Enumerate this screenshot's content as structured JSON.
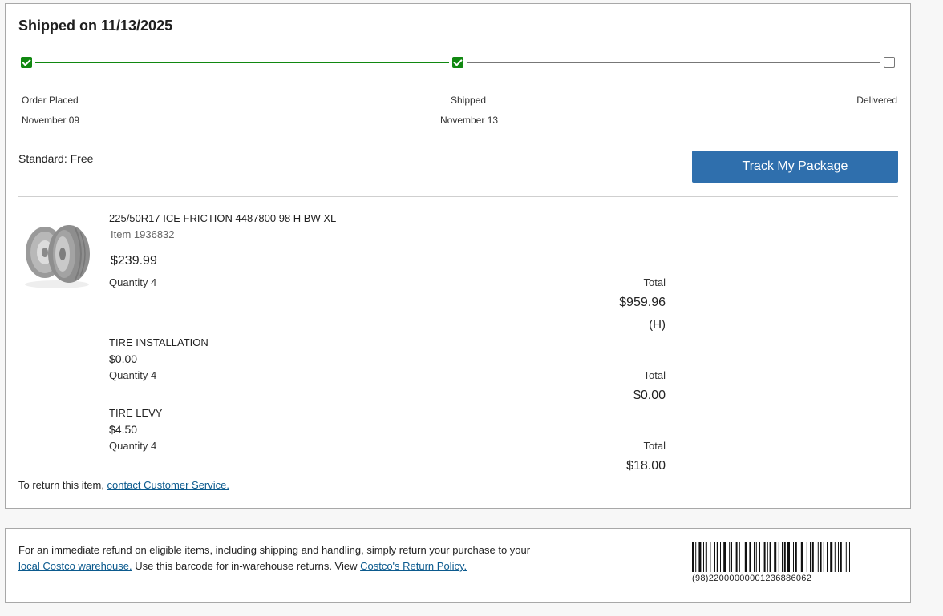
{
  "shipment": {
    "title": "Shipped on 11/13/2025",
    "steps": [
      {
        "label": "Order Placed",
        "date": "November 09",
        "status": "done"
      },
      {
        "label": "Shipped",
        "date": "November 13",
        "status": "done"
      },
      {
        "label": "Delivered",
        "date": "",
        "status": "pending"
      }
    ],
    "shipping_method": "Standard: Free",
    "track_button": "Track My Package"
  },
  "items": [
    {
      "name": "225/50R17 ICE FRICTION 4487800 98 H BW XL",
      "item_number": "Item 1936832",
      "price": "$239.99",
      "quantity": "Quantity 4",
      "total_label": "Total",
      "total": "$959.96",
      "tax_flag": "(H)",
      "image_icon": "tire-icon"
    },
    {
      "name": "TIRE INSTALLATION",
      "price": "$0.00",
      "quantity": "Quantity 4",
      "total_label": "Total",
      "total": "$0.00"
    },
    {
      "name": "TIRE LEVY",
      "price": "$4.50",
      "quantity": "Quantity 4",
      "total_label": "Total",
      "total": "$18.00"
    }
  ],
  "return_note": {
    "prefix": "To return this item, ",
    "link": "contact Customer Service."
  },
  "refund": {
    "text1": "For an immediate refund on eligible items, including shipping and handling, simply return your purchase to your ",
    "link1": "local Costco warehouse.",
    "text2": " Use this barcode for in-warehouse returns. View ",
    "link2": "Costco's Return Policy.",
    "barcode_number": "(98)22000000001236886062"
  },
  "colors": {
    "accent": "#2f6fad",
    "progress_done": "#118811",
    "link": "#0b5a8e"
  }
}
